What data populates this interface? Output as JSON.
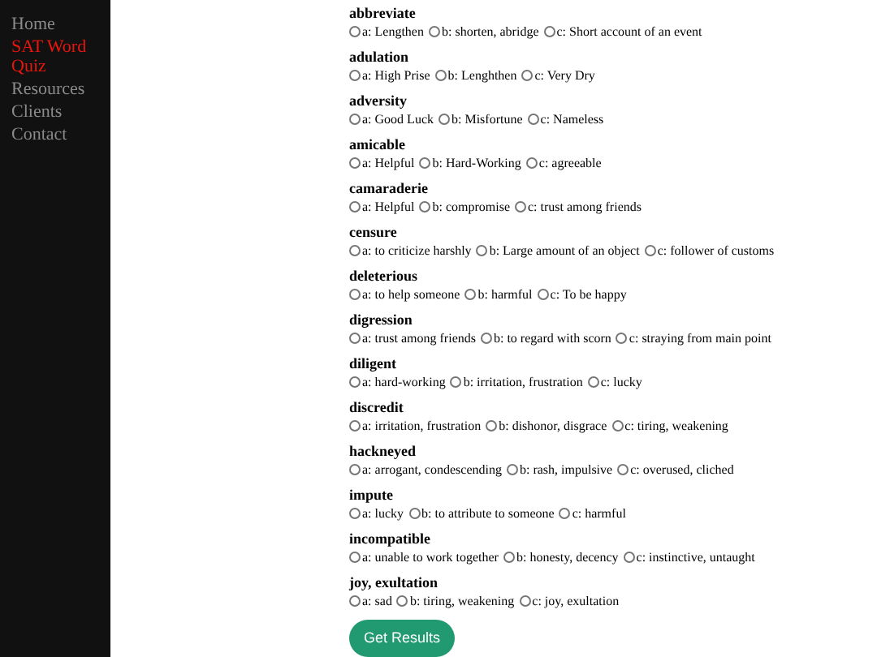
{
  "sidebar": {
    "items": [
      {
        "label": "Home",
        "selected": false
      },
      {
        "label": "SAT Word Quiz",
        "selected": true
      },
      {
        "label": "Resources",
        "selected": false
      },
      {
        "label": "Clients",
        "selected": false
      },
      {
        "label": "Contact",
        "selected": false
      }
    ]
  },
  "questions": [
    {
      "word": "abbreviate",
      "options": [
        {
          "label": "a: Lengthen",
          "selected": false
        },
        {
          "label": "b: shorten, abridge",
          "selected": false
        },
        {
          "label": "c: Short account of an event",
          "selected": false
        }
      ]
    },
    {
      "word": "adulation",
      "options": [
        {
          "label": "a: High Prise",
          "selected": false
        },
        {
          "label": "b: Lenghthen",
          "selected": false
        },
        {
          "label": "c: Very Dry",
          "selected": false
        }
      ]
    },
    {
      "word": "adversity",
      "options": [
        {
          "label": "a: Good Luck",
          "selected": false
        },
        {
          "label": "b: Misfortune",
          "selected": false
        },
        {
          "label": "c: Nameless",
          "selected": false
        }
      ]
    },
    {
      "word": "amicable",
      "options": [
        {
          "label": "a: Helpful",
          "selected": false
        },
        {
          "label": "b: Hard-Working",
          "selected": false
        },
        {
          "label": "c: agreeable",
          "selected": false
        }
      ]
    },
    {
      "word": "camaraderie",
      "options": [
        {
          "label": "a: Helpful",
          "selected": false
        },
        {
          "label": "b: compromise",
          "selected": false
        },
        {
          "label": "c: trust among friends",
          "selected": false
        }
      ]
    },
    {
      "word": "censure",
      "options": [
        {
          "label": "a: to criticize harshly",
          "selected": false
        },
        {
          "label": "b: Large amount of an object",
          "selected": false
        },
        {
          "label": "c: follower of customs",
          "selected": false
        }
      ]
    },
    {
      "word": "deleterious",
      "options": [
        {
          "label": "a: to help someone",
          "selected": false
        },
        {
          "label": "b: harmful",
          "selected": false
        },
        {
          "label": "c: To be happy",
          "selected": false
        }
      ]
    },
    {
      "word": "digression",
      "options": [
        {
          "label": "a: trust among friends",
          "selected": false
        },
        {
          "label": "b: to regard with scorn",
          "selected": false
        },
        {
          "label": "c: straying from main point",
          "selected": false
        }
      ]
    },
    {
      "word": "diligent",
      "options": [
        {
          "label": "a: hard-working",
          "selected": false
        },
        {
          "label": "b: irritation, frustration",
          "selected": false
        },
        {
          "label": "c: lucky",
          "selected": false
        }
      ]
    },
    {
      "word": "discredit",
      "options": [
        {
          "label": "a: irritation, frustration",
          "selected": false
        },
        {
          "label": "b: dishonor, disgrace",
          "selected": false
        },
        {
          "label": "c: tiring, weakening",
          "selected": false
        }
      ]
    },
    {
      "word": "hackneyed",
      "options": [
        {
          "label": "a: arrogant, condescending",
          "selected": false
        },
        {
          "label": "b: rash, impulsive",
          "selected": false
        },
        {
          "label": "c: overused, cliched",
          "selected": false
        }
      ]
    },
    {
      "word": "impute",
      "options": [
        {
          "label": "a: lucky",
          "selected": false
        },
        {
          "label": "b: to attribute to someone",
          "selected": false
        },
        {
          "label": "c: harmful",
          "selected": false
        }
      ]
    },
    {
      "word": "incompatible",
      "options": [
        {
          "label": "a: unable to work together",
          "selected": false
        },
        {
          "label": "b: honesty, decency",
          "selected": false
        },
        {
          "label": "c: instinctive, untaught",
          "selected": false
        }
      ]
    },
    {
      "word": "joy, exultation",
      "options": [
        {
          "label": "a: sad",
          "selected": false
        },
        {
          "label": "b: tiring, weakening",
          "selected": false
        },
        {
          "label": "c: joy, exultation",
          "selected": false
        }
      ]
    }
  ],
  "submit_button": "Get Results"
}
